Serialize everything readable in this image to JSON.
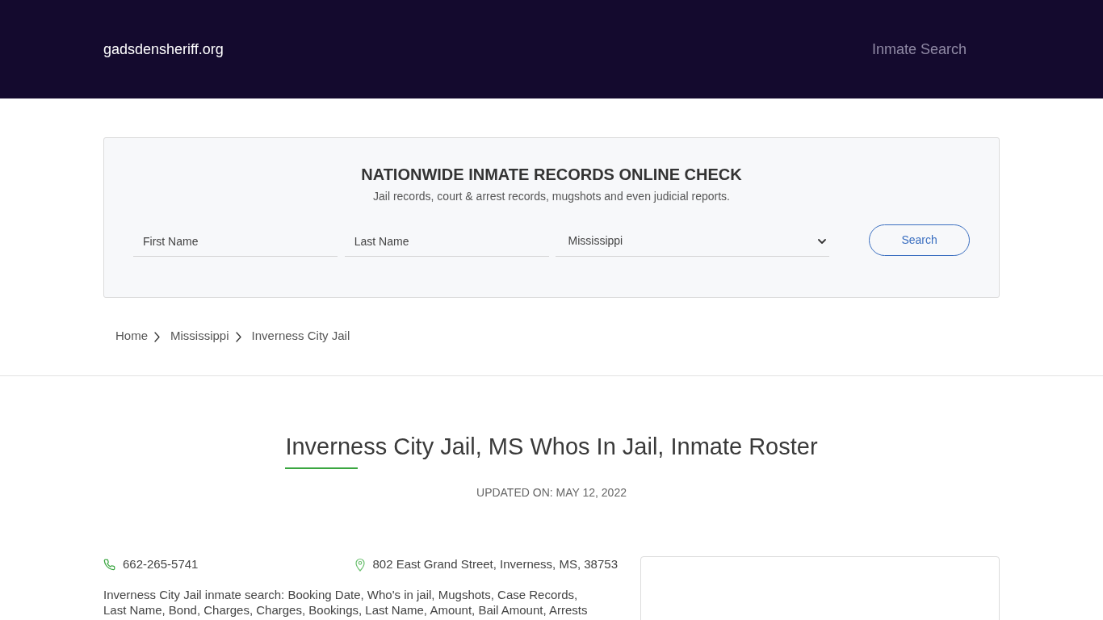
{
  "header": {
    "logo": "gadsdensheriff.org",
    "nav": [
      {
        "label": "Inmate Search"
      }
    ]
  },
  "search_panel": {
    "title": "NATIONWIDE INMATE RECORDS ONLINE CHECK",
    "subtitle": "Jail records, court & arrest records, mugshots and even judicial reports.",
    "fields": [
      {
        "kind": "text",
        "placeholder": "First Name"
      },
      {
        "kind": "text",
        "placeholder": "Last Name"
      },
      {
        "kind": "select",
        "value": "Mississippi"
      }
    ],
    "button": "Search"
  },
  "breadcrumb": [
    {
      "label": "Home"
    },
    {
      "label": "Mississippi"
    },
    {
      "label": "Inverness City Jail"
    }
  ],
  "page": {
    "title": "Inverness City Jail, MS Whos In Jail, Inmate Roster",
    "updated": "UPDATED ON: MAY 12, 2022",
    "phone": "662-265-5741",
    "address": "802 East Grand Street, Inverness, MS, 38753",
    "description": "Inverness City Jail inmate search: Booking Date, Who's in jail, Mugshots, Case Records, Last Name, Bond, Charges, Charges, Bookings, Last Name, Amount, Bail Amount, Arrests"
  }
}
